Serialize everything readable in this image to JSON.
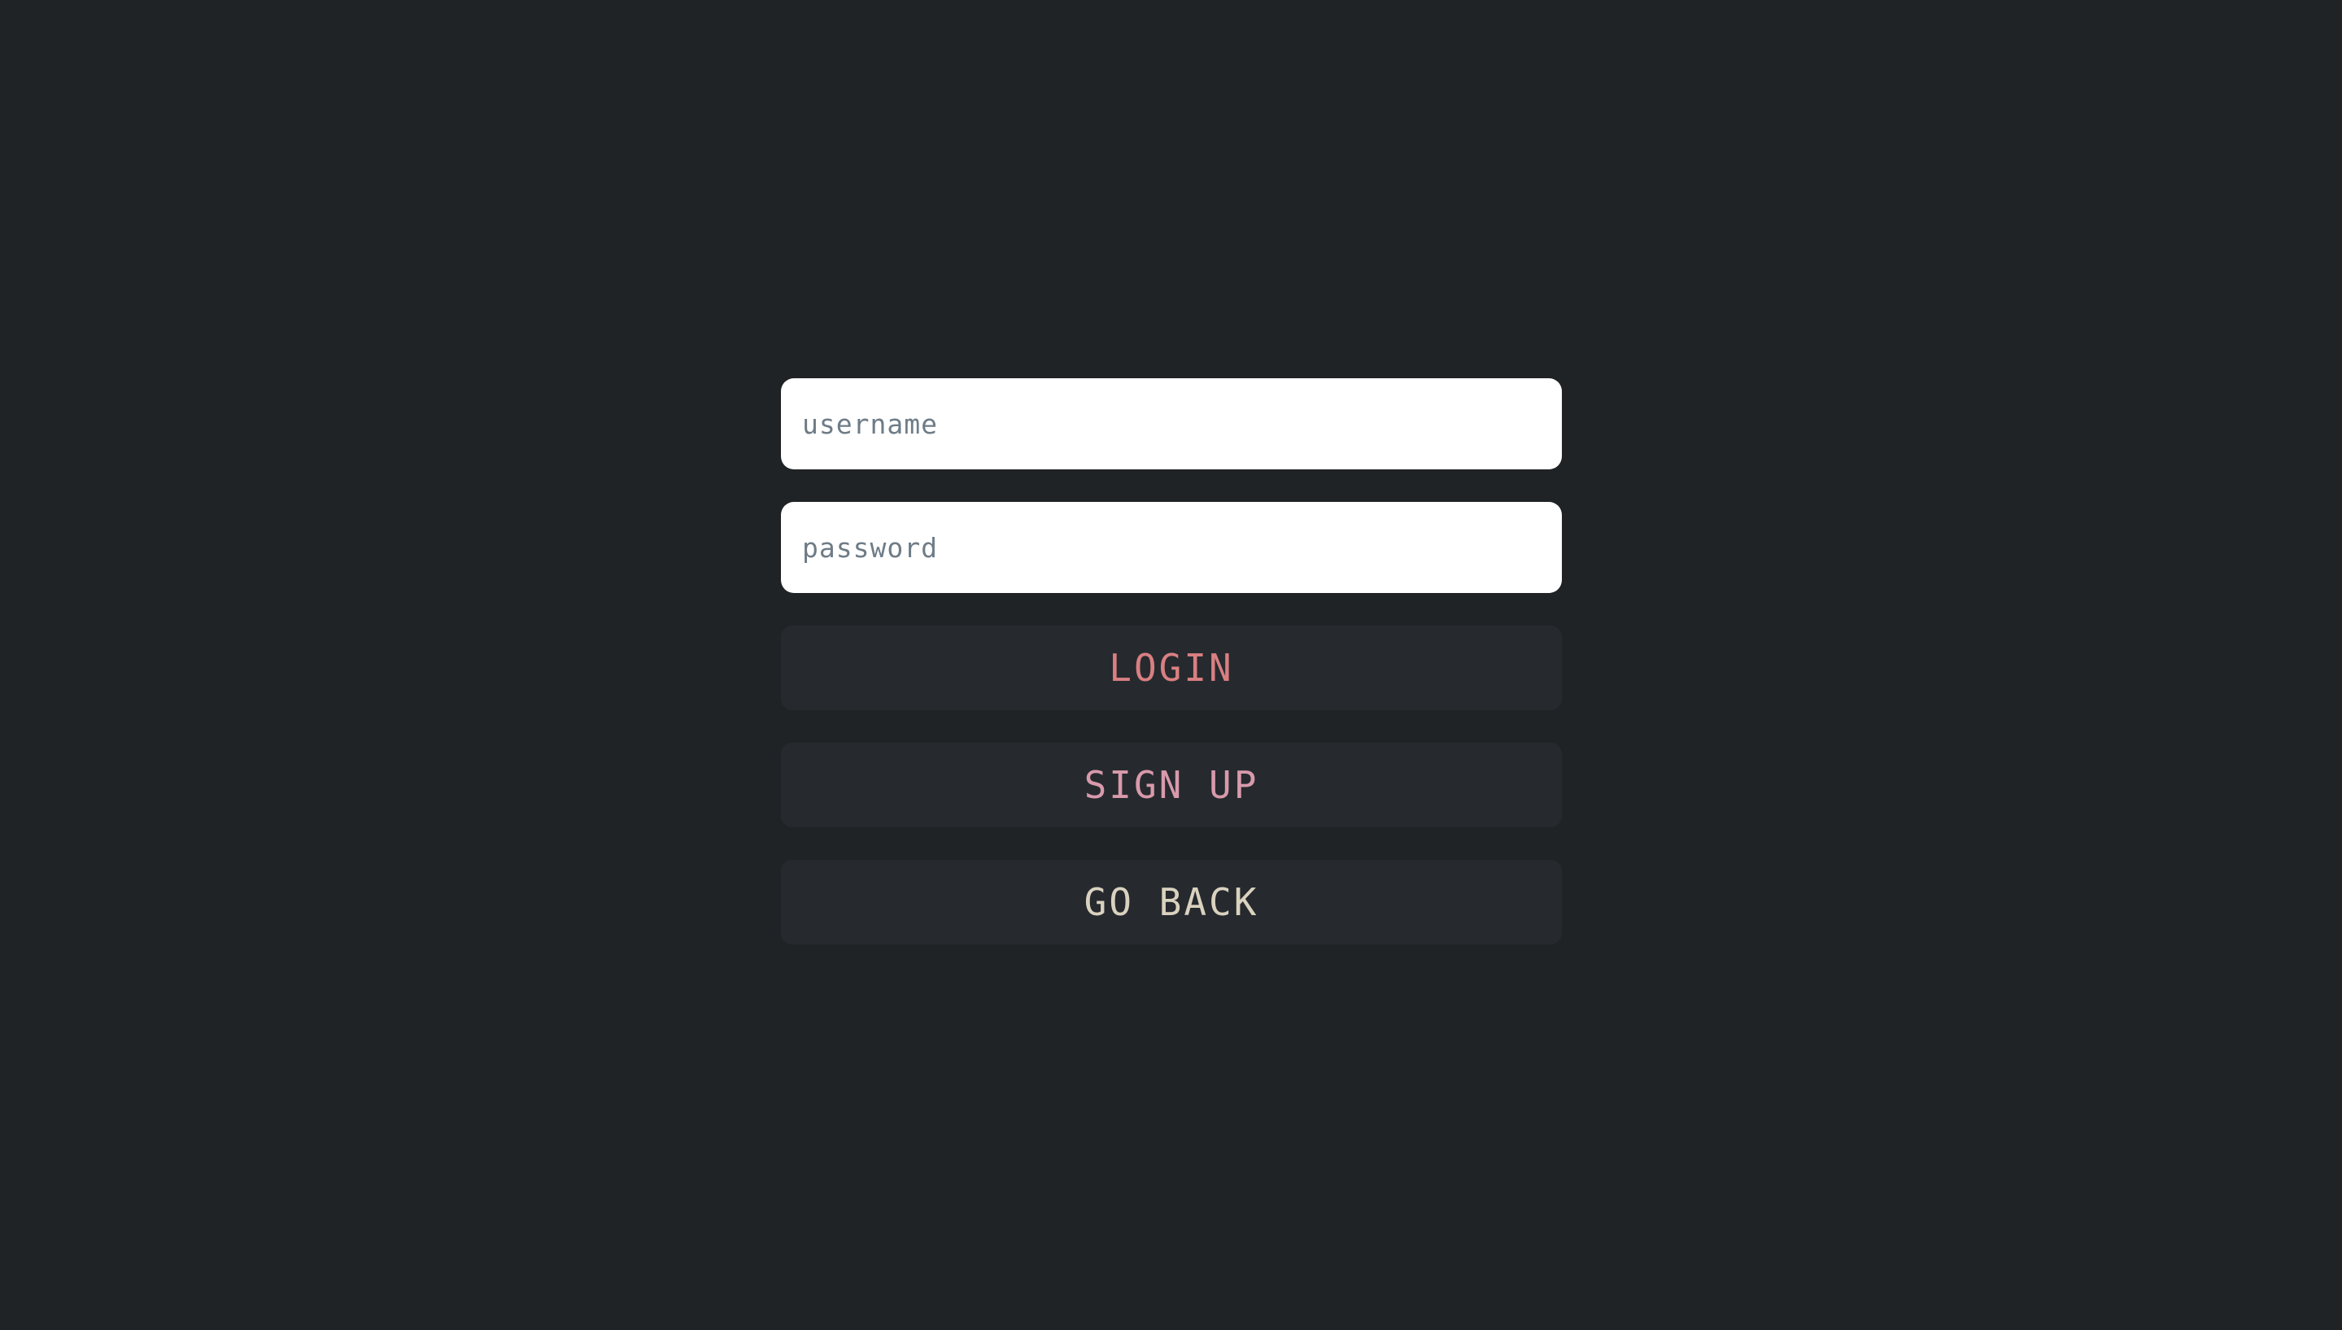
{
  "form": {
    "username": {
      "placeholder": "username",
      "value": ""
    },
    "password": {
      "placeholder": "password",
      "value": ""
    }
  },
  "buttons": {
    "login_label": "LOGIN",
    "signup_label": "SIGN UP",
    "back_label": "GO BACK"
  },
  "colors": {
    "background": "#202326",
    "field_background": "#ffffff",
    "placeholder": "#6e7c87",
    "button_background": "#262a2e",
    "login": "#d97f82",
    "signup": "#d89aac",
    "back": "#d9d2bf"
  }
}
